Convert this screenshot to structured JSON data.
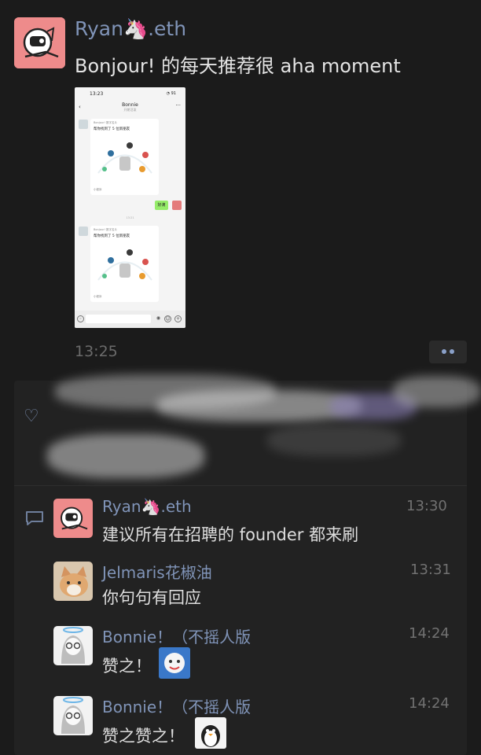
{
  "post": {
    "author": "Ryan🦄.eth",
    "text": "Bonjour! 的每天推荐很 aha moment",
    "time": "13:25",
    "screenshot": {
      "status_time": "13:23",
      "status_right": "◔ 91",
      "chat_title": "Bonnie",
      "chat_subtitle": "开朗活泼",
      "card_head": "Bonjour! 数字名片",
      "card_text": "帮你找到了 5 位新朋友",
      "card_footer": "小程序",
      "reply_text": "好滴",
      "mid_time": "13:21"
    }
  },
  "comments": [
    {
      "name": "Ryan🦄.eth",
      "time": "13:30",
      "text": "建议所有在招聘的 founder 都来刷"
    },
    {
      "name": "Jelmaris花椒油",
      "time": "13:31",
      "text": "你句句有回应"
    },
    {
      "name": "Bonnie！（不摇人版",
      "time": "14:24",
      "text": "赞之！"
    },
    {
      "name": "Bonnie！（不摇人版",
      "time": "14:24",
      "text": "赞之赞之！"
    }
  ],
  "icons": [
    "more-dots-icon",
    "heart-icon",
    "comment-icon",
    "back-icon",
    "voice-icon",
    "emoji-icon",
    "add-icon"
  ],
  "colors": {
    "background": "#1b1b1b",
    "name": "#8094b8",
    "panel": "#222222"
  }
}
